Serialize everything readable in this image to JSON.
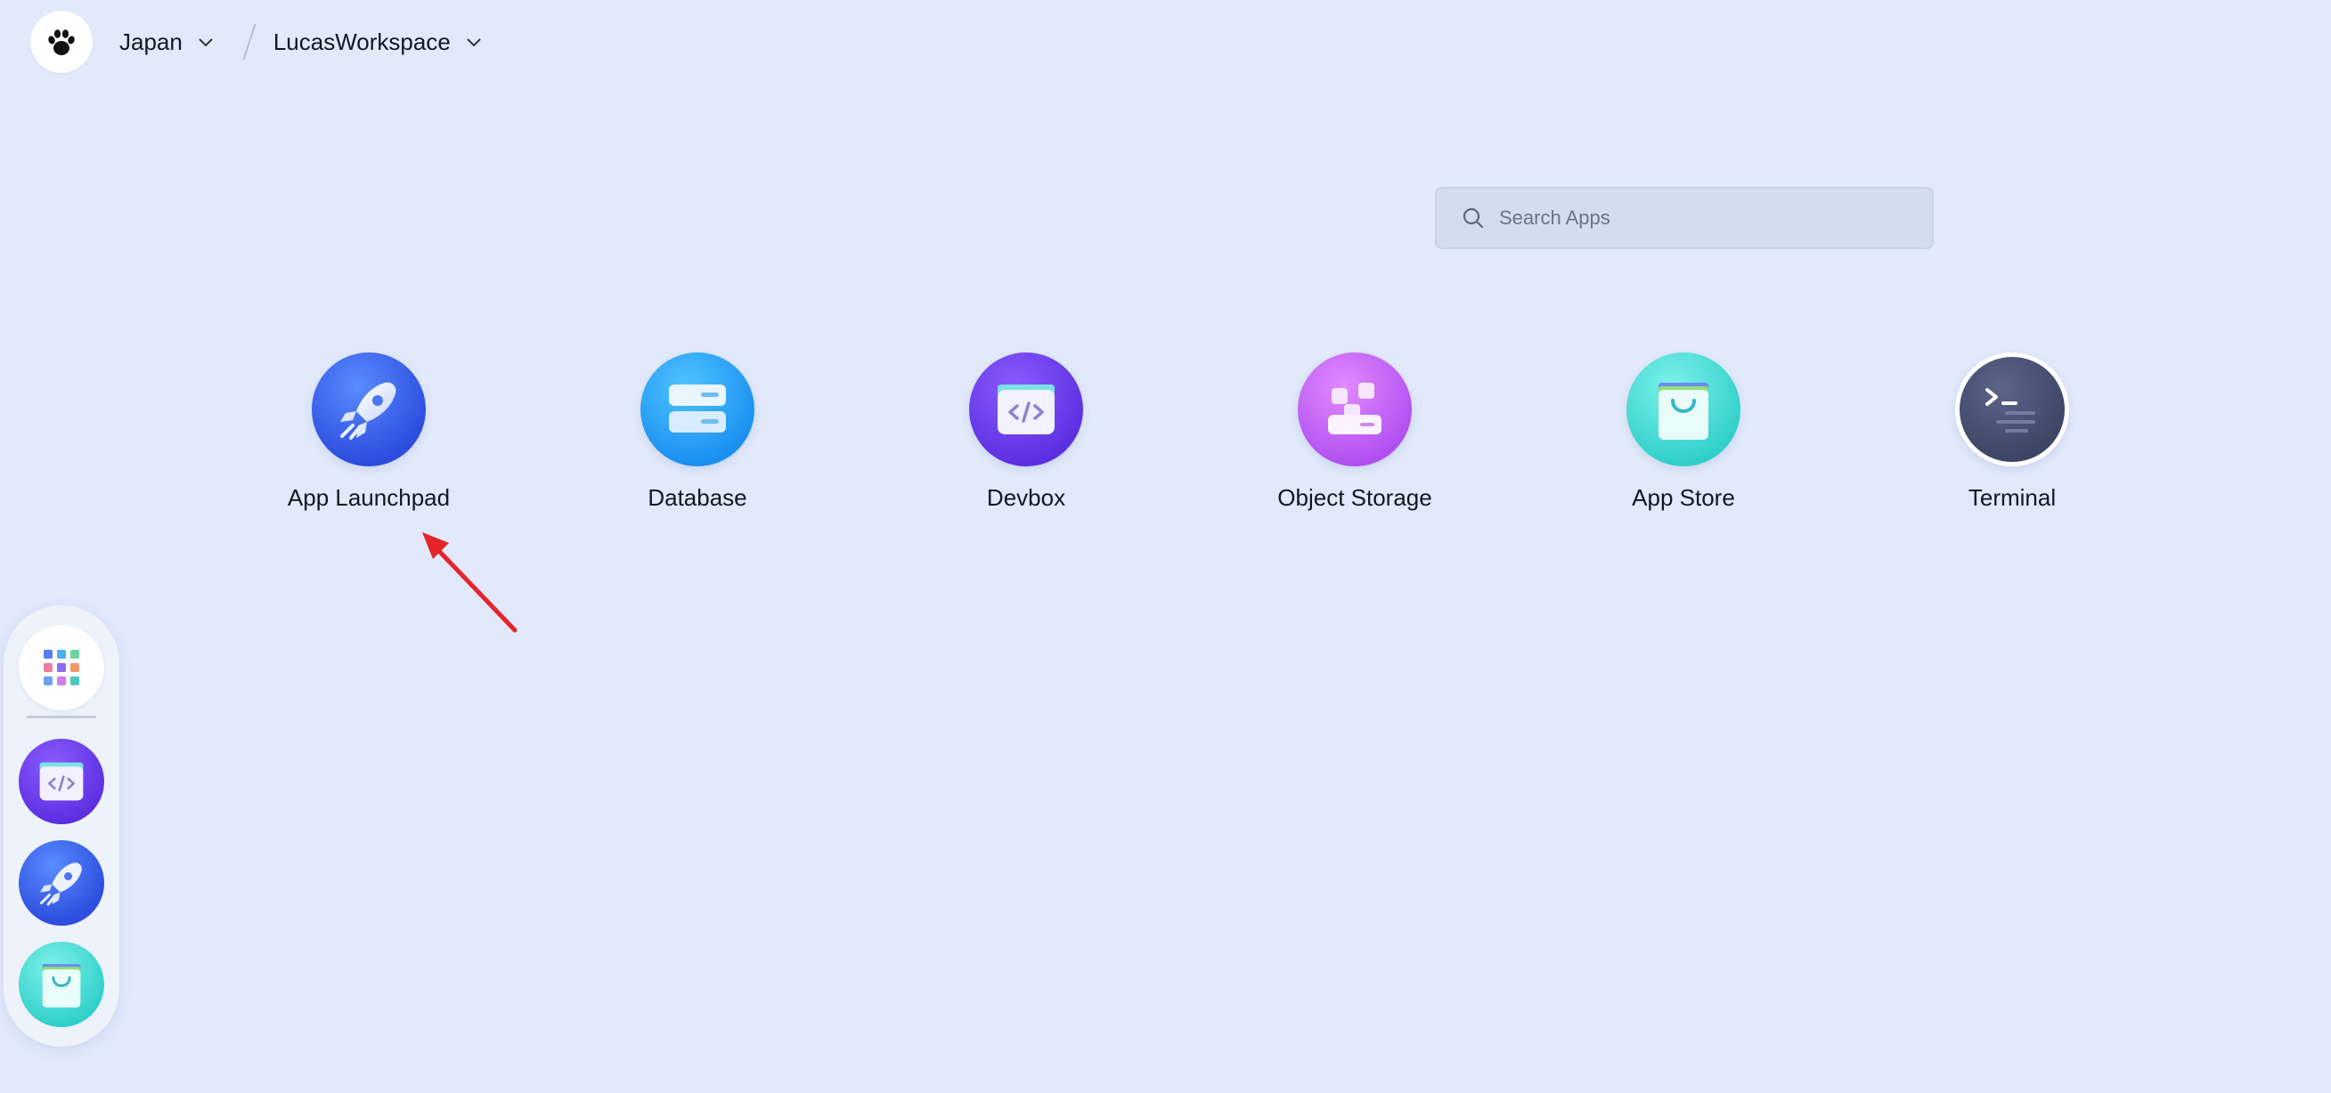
{
  "topbar": {
    "region": "Japan",
    "workspace": "LucasWorkspace"
  },
  "search": {
    "placeholder": "Search Apps"
  },
  "apps": [
    {
      "label": "App Launchpad",
      "icon": "rocket-icon"
    },
    {
      "label": "Database",
      "icon": "database-icon"
    },
    {
      "label": "Devbox",
      "icon": "devbox-icon"
    },
    {
      "label": "Object Storage",
      "icon": "object-storage-icon"
    },
    {
      "label": "App Store",
      "icon": "shopping-bag-icon"
    },
    {
      "label": "Terminal",
      "icon": "terminal-icon"
    }
  ],
  "dock": {
    "items": [
      "apps-grid-icon",
      "devbox-icon",
      "rocket-icon",
      "shopping-bag-icon"
    ]
  },
  "colors": {
    "background": "#e1e9fb",
    "annotation_arrow": "#e5232a"
  }
}
